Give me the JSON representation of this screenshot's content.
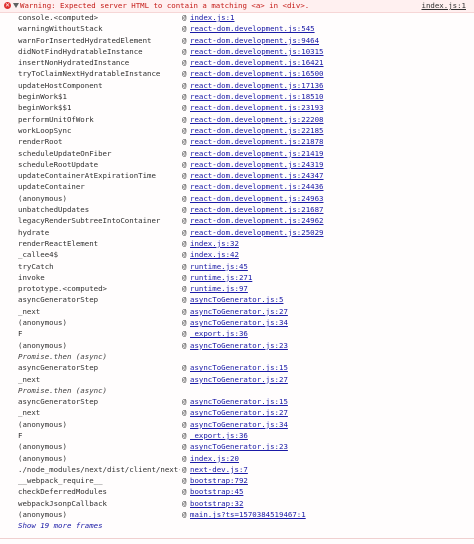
{
  "header": {
    "message": "Warning: Expected server HTML to contain a matching <a> in <div>.",
    "source": "index.js:1",
    "icon": "error-icon",
    "toggle_icon": "disclosure-triangle-icon"
  },
  "frames": [
    {
      "fn": "console.<computed>",
      "src": "index.js:1"
    },
    {
      "fn": "warningWithoutStack",
      "src": "react-dom.development.js:545"
    },
    {
      "fn": "warnForInsertedHydratedElement",
      "src": "react-dom.development.js:9464"
    },
    {
      "fn": "didNotFindHydratableInstance",
      "src": "react-dom.development.js:10315"
    },
    {
      "fn": "insertNonHydratedInstance",
      "src": "react-dom.development.js:16421"
    },
    {
      "fn": "tryToClaimNextHydratableInstance",
      "src": "react-dom.development.js:16500"
    },
    {
      "fn": "updateHostComponent",
      "src": "react-dom.development.js:17136"
    },
    {
      "fn": "beginWork$1",
      "src": "react-dom.development.js:18510"
    },
    {
      "fn": "beginWork$$1",
      "src": "react-dom.development.js:23193"
    },
    {
      "fn": "performUnitOfWork",
      "src": "react-dom.development.js:22208"
    },
    {
      "fn": "workLoopSync",
      "src": "react-dom.development.js:22185"
    },
    {
      "fn": "renderRoot",
      "src": "react-dom.development.js:21878"
    },
    {
      "fn": "scheduleUpdateOnFiber",
      "src": "react-dom.development.js:21419"
    },
    {
      "fn": "scheduleRootUpdate",
      "src": "react-dom.development.js:24319"
    },
    {
      "fn": "updateContainerAtExpirationTime",
      "src": "react-dom.development.js:24347"
    },
    {
      "fn": "updateContainer",
      "src": "react-dom.development.js:24436"
    },
    {
      "fn": "(anonymous)",
      "src": "react-dom.development.js:24963"
    },
    {
      "fn": "unbatchedUpdates",
      "src": "react-dom.development.js:21687"
    },
    {
      "fn": "legacyRenderSubtreeIntoContainer",
      "src": "react-dom.development.js:24962"
    },
    {
      "fn": "hydrate",
      "src": "react-dom.development.js:25029"
    },
    {
      "fn": "renderReactElement",
      "src": "index.js:32"
    },
    {
      "fn": "_callee4$",
      "src": "index.js:42"
    },
    {
      "fn": "tryCatch",
      "src": "runtime.js:45"
    },
    {
      "fn": "invoke",
      "src": "runtime.js:271"
    },
    {
      "fn": "prototype.<computed>",
      "src": "runtime.js:97"
    },
    {
      "fn": "asyncGeneratorStep",
      "src": "asyncToGenerator.js:5"
    },
    {
      "fn": "_next",
      "src": "asyncToGenerator.js:27"
    },
    {
      "fn": "(anonymous)",
      "src": "asyncToGenerator.js:34"
    },
    {
      "fn": "F",
      "src": "_export.js:36"
    },
    {
      "fn": "(anonymous)",
      "src": "asyncToGenerator.js:23"
    },
    {
      "fn": "Promise.then (async)",
      "async": true
    },
    {
      "fn": "asyncGeneratorStep",
      "src": "asyncToGenerator.js:15"
    },
    {
      "fn": "_next",
      "src": "asyncToGenerator.js:27"
    },
    {
      "fn": "Promise.then (async)",
      "async": true
    },
    {
      "fn": "asyncGeneratorStep",
      "src": "asyncToGenerator.js:15"
    },
    {
      "fn": "_next",
      "src": "asyncToGenerator.js:27"
    },
    {
      "fn": "(anonymous)",
      "src": "asyncToGenerator.js:34"
    },
    {
      "fn": "F",
      "src": "_export.js:36"
    },
    {
      "fn": "(anonymous)",
      "src": "asyncToGenerator.js:23"
    },
    {
      "fn": "(anonymous)",
      "src": "index.js:20"
    },
    {
      "fn": "./node_modules/next/dist/client/next-dev.js",
      "src": "next-dev.js:7"
    },
    {
      "fn": "__webpack_require__",
      "src": "bootstrap:792"
    },
    {
      "fn": "checkDeferredModules",
      "src": "bootstrap:45"
    },
    {
      "fn": "webpackJsonpCallback",
      "src": "bootstrap:32"
    },
    {
      "fn": "(anonymous)",
      "src": "main.js?ts=1570384519467:1"
    }
  ],
  "at_symbol": "@",
  "show_more": "Show 19 more frames",
  "colors": {
    "error": "#c41a16",
    "link": "#1a1aa6",
    "header_bg": "#fff0f0"
  }
}
